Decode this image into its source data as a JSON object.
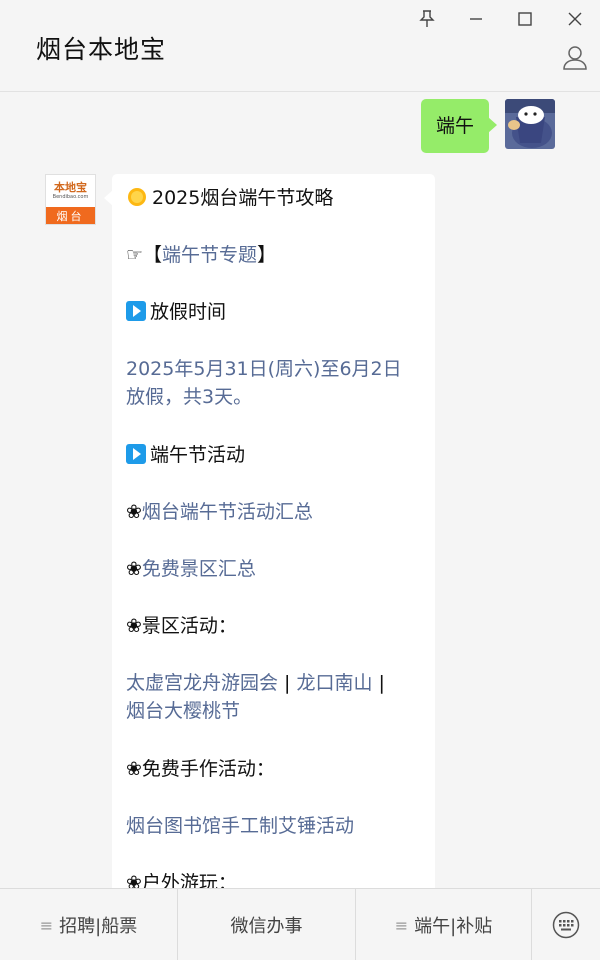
{
  "window": {
    "title": "烟台本地宝",
    "controls": {
      "pin": "pin-icon",
      "minimize": "minimize-icon",
      "maximize": "maximize-icon",
      "close": "close-icon"
    },
    "profile_icon": "user-icon"
  },
  "messages": {
    "sent": {
      "text": "端午"
    },
    "received": {
      "avatar": {
        "logo_text": "本地宝",
        "logo_url": "Bendibao.com",
        "city": "烟台"
      },
      "title": "2025烟台端午节攻略",
      "topic_prefix": "☞【",
      "topic_link": "端午节专题",
      "topic_suffix": "】",
      "holiday_heading": "放假时间",
      "holiday_line1": "2025年5月31日(周六)至6月2日",
      "holiday_line2": "放假，共3天。",
      "activities_heading": "端午节活动",
      "flower": "❀",
      "link_activities": "烟台端午节活动汇总",
      "link_free_scenic": "免费景区汇总",
      "scenic_heading": "景区活动：",
      "scenic_link1": "太虚宫龙舟游园会",
      "scenic_sep1": " | ",
      "scenic_link2": "龙口南山",
      "scenic_sep2": " |",
      "scenic_link3": "烟台大樱桃节",
      "craft_heading": "免费手作活动：",
      "craft_link": "烟台图书馆手工制艾锤活动",
      "outdoor_heading": "户外游玩："
    }
  },
  "bottom_menu": {
    "items": [
      {
        "label": "招聘|船票",
        "has_submenu": true
      },
      {
        "label": "微信办事",
        "has_submenu": false
      },
      {
        "label": "端午|补贴",
        "has_submenu": true
      }
    ],
    "keyboard_icon": "keyboard-icon"
  },
  "colors": {
    "sent_bubble": "#95ec69",
    "link": "#576b95",
    "logo_orange": "#f06a1e",
    "play_icon": "#1e9be9"
  }
}
